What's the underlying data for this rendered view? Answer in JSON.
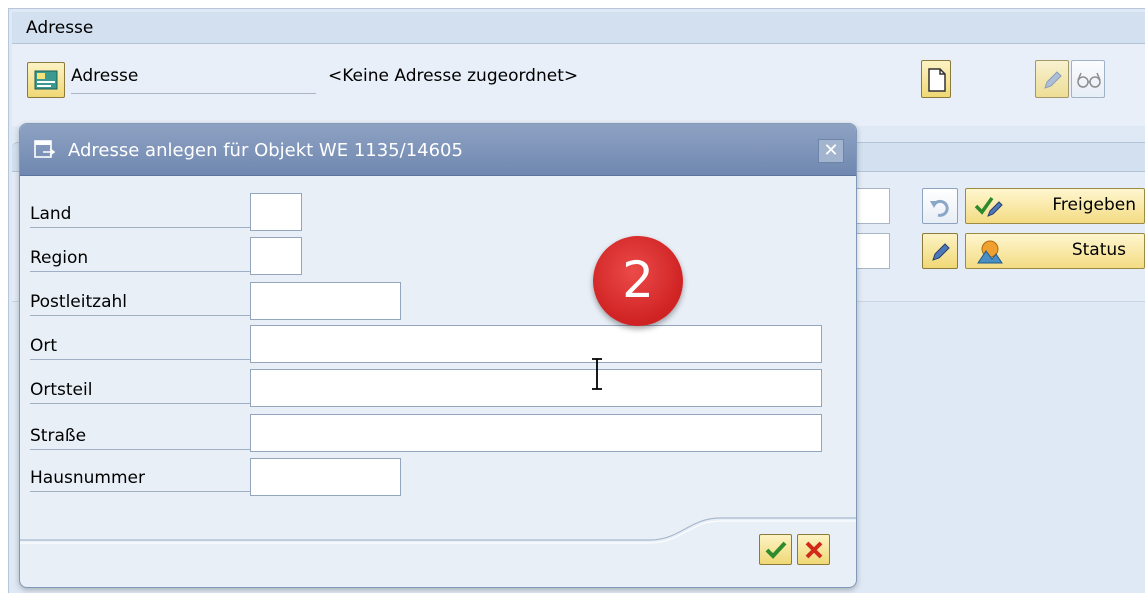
{
  "background": {
    "section_title": "Adresse",
    "address_label": "Adresse",
    "no_address_text": "<Keine Adresse zugeordnet>",
    "release_button": "Freigeben",
    "status_button": "Status"
  },
  "dialog": {
    "title": "Adresse anlegen für Objekt WE 1135/14605",
    "fields": [
      {
        "label": "Land",
        "value": ""
      },
      {
        "label": "Region",
        "value": ""
      },
      {
        "label": "Postleitzahl",
        "value": ""
      },
      {
        "label": "Ort",
        "value": ""
      },
      {
        "label": "Ortsteil",
        "value": ""
      },
      {
        "label": "Straße",
        "value": ""
      },
      {
        "label": "Hausnummer",
        "value": ""
      }
    ]
  },
  "annotation": {
    "step_number": "2"
  },
  "colors": {
    "dialog_titlebar": "#7a90b6",
    "background_panel": "#dfe9f5",
    "badge": "#d92b2b",
    "yellow_button": "#f3dc83"
  },
  "icons": {
    "address_button": "address-book-icon",
    "new_doc": "new-document-icon",
    "edit": "pencil-icon",
    "display": "glasses-icon",
    "undo": "undo-icon",
    "release": "check-pencil-icon",
    "status": "status-icon",
    "confirm": "checkmark-icon",
    "cancel": "cancel-icon"
  }
}
